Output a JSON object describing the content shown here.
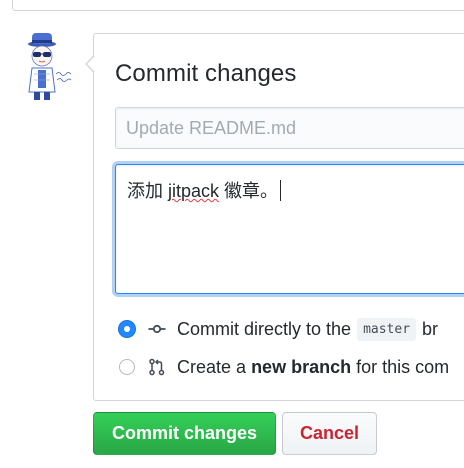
{
  "form": {
    "title": "Commit changes",
    "summary_placeholder": "Update README.md",
    "summary_value": "",
    "description": {
      "before": "添加 ",
      "misspelled": "jitpack",
      "after": " 徽章。"
    }
  },
  "options": {
    "direct": {
      "selected": true,
      "icon": "git-commit-icon",
      "label_before": "Commit directly to the",
      "branch": "master",
      "label_after": "br"
    },
    "new_branch": {
      "selected": false,
      "icon": "git-pull-request-icon",
      "label_before": "Create a",
      "label_bold": "new branch",
      "label_after": "for this com"
    }
  },
  "buttons": {
    "commit_label": "Commit changes",
    "cancel_label": "Cancel"
  },
  "colors": {
    "commit_button": "#28a745",
    "cancel_text": "#cb2431",
    "focus_border": "#2188ff",
    "radio_selected": "#2188ff"
  }
}
